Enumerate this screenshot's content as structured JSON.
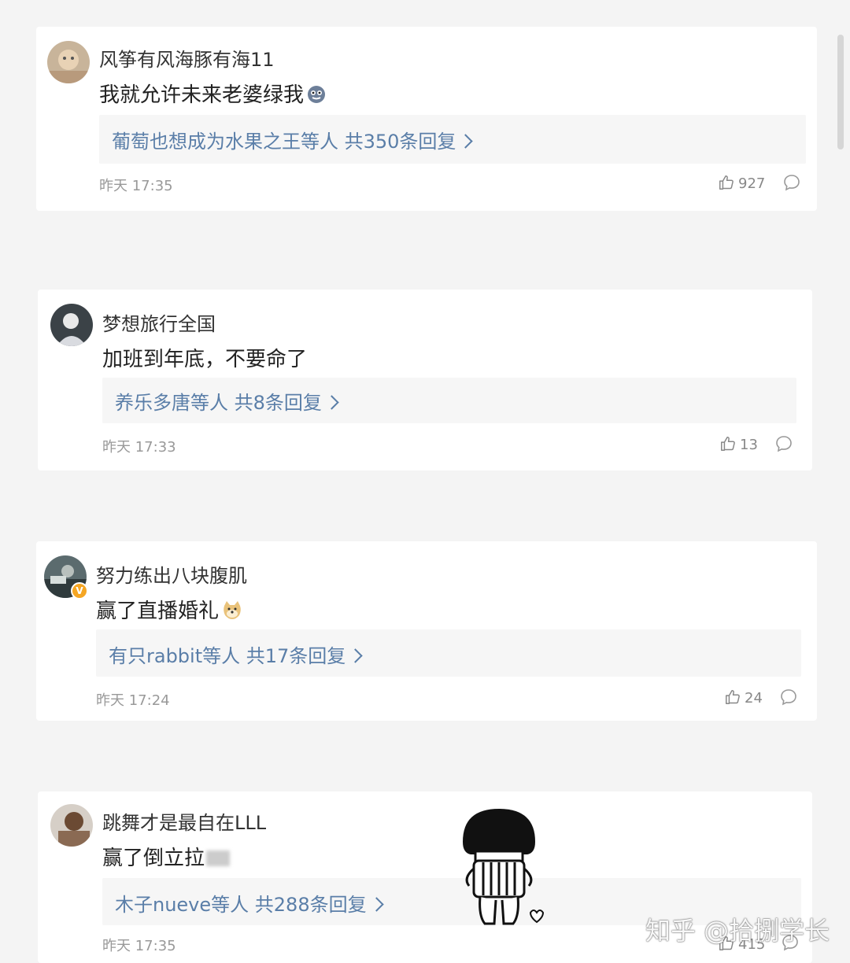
{
  "comments": [
    {
      "username": "风筝有风海豚有海11",
      "text": "我就允许未来老婆绿我",
      "emoji": "face-emoji",
      "replies_label": "葡萄也想成为水果之王等人 共350条回复",
      "time": "昨天 17:35",
      "likes": "927"
    },
    {
      "username": "梦想旅行全国",
      "text": "加班到年底，不要命了",
      "replies_label": "养乐多唐等人 共8条回复",
      "time": "昨天 17:33",
      "likes": "13"
    },
    {
      "username": "努力练出八块腹肌",
      "text": "赢了直播婚礼",
      "emoji": "doge-emoji",
      "verified": "V",
      "replies_label": "有只rabbit等人 共17条回复",
      "time": "昨天 17:24",
      "likes": "24"
    },
    {
      "username": "跳舞才是最自在LLL",
      "text": "赢了倒立拉",
      "replies_label": "木子nueve等人 共288条回复",
      "time": "昨天 17:35",
      "likes": "415"
    }
  ],
  "watermark": "知乎 @拾捌学长",
  "colors": {
    "link": "#5a7ea8",
    "background": "#f4f4f4",
    "card": "#ffffff",
    "reply_bg": "#f6f6f6"
  }
}
